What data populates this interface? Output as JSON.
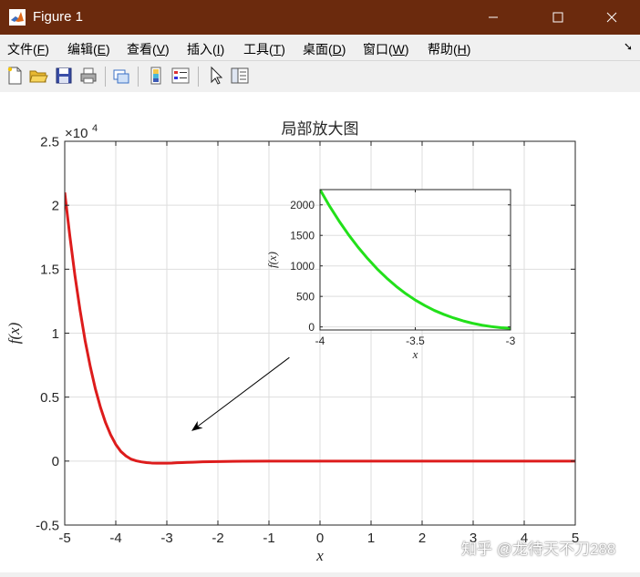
{
  "window": {
    "title": "Figure 1",
    "controls": {
      "minimize": "minimize-icon",
      "maximize": "maximize-icon",
      "close": "close-icon"
    }
  },
  "menu": {
    "items": [
      {
        "label": "文件(",
        "key": "F",
        "end": ")"
      },
      {
        "label": "编辑(",
        "key": "E",
        "end": ")"
      },
      {
        "label": "查看(",
        "key": "V",
        "end": ")"
      },
      {
        "label": "插入(",
        "key": "I",
        "end": ")"
      },
      {
        "label": "工具(",
        "key": "T",
        "end": ")"
      },
      {
        "label": "桌面(",
        "key": "D",
        "end": ")"
      },
      {
        "label": "窗口(",
        "key": "W",
        "end": ")"
      },
      {
        "label": "帮助(",
        "key": "H",
        "end": ")"
      }
    ]
  },
  "toolbar": {
    "icons": [
      "new-figure-icon",
      "open-file-icon",
      "save-icon",
      "print-icon",
      "link-icon",
      "colorbar-icon",
      "legend-icon",
      "pointer-icon",
      "property-editor-icon"
    ]
  },
  "watermark": "知乎 @龙待天不刀288",
  "chart_data": [
    {
      "type": "line",
      "title": "局部放大图",
      "xlabel": "x",
      "ylabel": "f(x)",
      "xlim": [
        -5,
        5
      ],
      "ylim": [
        -5000,
        25000
      ],
      "y_exponent_label": "×10",
      "y_exponent_power": "4",
      "xticks": [
        -5,
        -4,
        -3,
        -2,
        -1,
        0,
        1,
        2,
        3,
        4,
        5
      ],
      "yticks": [
        -0.5,
        0,
        0.5,
        1,
        1.5,
        2,
        2.5
      ],
      "grid": true,
      "series": [
        {
          "color": "#dd1c1c",
          "x": [
            -5,
            -4.9,
            -4.8,
            -4.7,
            -4.6,
            -4.5,
            -4.4,
            -4.3,
            -4.2,
            -4.1,
            -4,
            -3.9,
            -3.8,
            -3.7,
            -3.6,
            -3.5,
            -3.4,
            -3.3,
            -3.2,
            -3.1,
            -3,
            -2.9,
            -2.8,
            -2.7,
            -2.6,
            -2.5,
            -2.3,
            -2,
            -1.5,
            -1,
            0,
            1,
            2,
            3,
            4,
            5
          ],
          "y": [
            21000,
            17600,
            14500,
            11800,
            9400,
            7400,
            5650,
            4200,
            3000,
            2050,
            1300,
            750,
            400,
            150,
            20,
            -60,
            -120,
            -150,
            -160,
            -165,
            -160,
            -150,
            -130,
            -115,
            -100,
            -90,
            -60,
            -35,
            -15,
            -6,
            -2,
            -1,
            0,
            0,
            0,
            0
          ]
        }
      ],
      "annotation": {
        "type": "arrow",
        "from": [
          -0.6,
          8100
        ],
        "to": [
          -2.5,
          2400
        ]
      }
    },
    {
      "type": "line",
      "title": "",
      "xlabel": "x",
      "ylabel": "f(x)",
      "xlim": [
        -4,
        -3
      ],
      "ylim": [
        -50,
        2250
      ],
      "xticks": [
        -4,
        -3.5,
        -3
      ],
      "yticks": [
        0,
        500,
        1000,
        1500,
        2000
      ],
      "grid": true,
      "series": [
        {
          "color": "#22e01a",
          "x": [
            -4,
            -3.95,
            -3.9,
            -3.85,
            -3.8,
            -3.75,
            -3.7,
            -3.65,
            -3.6,
            -3.55,
            -3.5,
            -3.45,
            -3.4,
            -3.35,
            -3.3,
            -3.25,
            -3.2,
            -3.15,
            -3.1,
            -3.05,
            -3
          ],
          "y": [
            2250,
            1980,
            1735,
            1510,
            1305,
            1120,
            950,
            800,
            665,
            545,
            440,
            350,
            270,
            205,
            148,
            100,
            60,
            28,
            5,
            -12,
            -22
          ]
        }
      ]
    }
  ]
}
